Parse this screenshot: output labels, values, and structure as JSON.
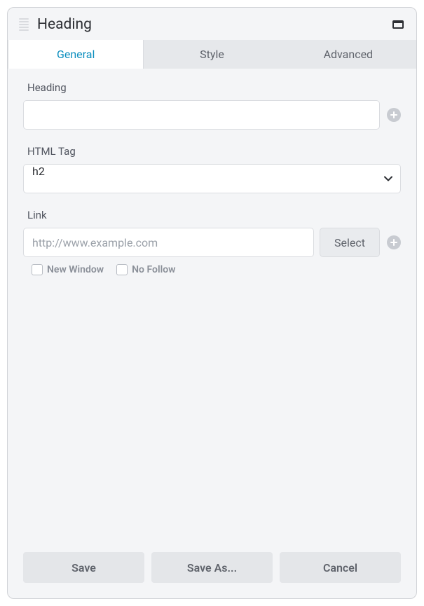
{
  "header": {
    "title": "Heading"
  },
  "tabs": {
    "items": [
      {
        "label": "General",
        "active": true
      },
      {
        "label": "Style",
        "active": false
      },
      {
        "label": "Advanced",
        "active": false
      }
    ]
  },
  "fields": {
    "heading": {
      "label": "Heading",
      "value": ""
    },
    "html_tag": {
      "label": "HTML Tag",
      "value": "h2"
    },
    "link": {
      "label": "Link",
      "placeholder": "http://www.example.com",
      "value": "",
      "select_btn": "Select",
      "new_window": {
        "label": "New Window",
        "checked": false
      },
      "no_follow": {
        "label": "No Follow",
        "checked": false
      }
    }
  },
  "footer": {
    "save": "Save",
    "save_as": "Save As...",
    "cancel": "Cancel"
  }
}
